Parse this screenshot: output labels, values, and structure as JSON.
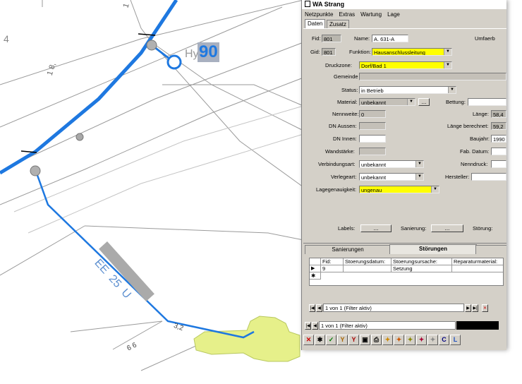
{
  "map": {
    "label_4": "4",
    "label_hy": "Hy",
    "label_90": "90",
    "label_18": "1 8,",
    "label_1": "1",
    "pipe_label": "EE  25  U",
    "label_32": "3,2",
    "label_66": "6 6"
  },
  "window": {
    "title": "WA Strang",
    "menu": [
      "Netzpunkte",
      "Extras",
      "Wartung",
      "Lage"
    ],
    "tabs": [
      "Daten",
      "Zusatz"
    ],
    "umfeld_label": "Umfaerb"
  },
  "form": {
    "fid_label": "Fid:",
    "fid_value": "801",
    "gid_label": "Gid:",
    "gid_value": "801",
    "name_label": "Name:",
    "name_value": "A. 631-A",
    "funktion_label": "Funktion:",
    "funktion_value": "Hausanschlussleitung",
    "druckzone_label": "Druckzone:",
    "druckzone_value": "Dorf/Bad 1",
    "gemeinde_label": "Gemeinde",
    "status_label": "Status:",
    "status_value": "in Betrieb",
    "material_label": "Material:",
    "material_value": "unbekannt",
    "material_btn": "...",
    "bettung_label": "Bettung:",
    "nennweite_label": "Nennweite:",
    "nennweite_value": "0",
    "laenge_label": "Länge:",
    "laenge_value": "58,4",
    "dn_aussen_label": "DN Aussen:",
    "laenge_ber_label": "Länge berechnet:",
    "laenge_ber_value": "59,2",
    "dn_innen_label": "DN Innen:",
    "baujahr_label": "Baujahr:",
    "baujahr_value": "1990",
    "wandstaerke_label": "Wandstärke:",
    "fab_datum_label": "Fab. Datum:",
    "verbindungsart_label": "Verbindungsart:",
    "verbindungsart_value": "unbekannt",
    "nenndruck_label": "Nenndruck:",
    "verlegeart_label": "Verlegeart:",
    "verlegeart_value": "unbekannt",
    "hersteller_label": "Hersteller:",
    "lagegenauigkeit_label": "Lagegenauigkeit:",
    "lagegenauigkeit_value": "ungenau",
    "labels_label": "Labels:",
    "labels_btn": "...",
    "sanierung_label": "Sanierung:",
    "sanierung_btn": "...",
    "stoerung_label": "Störung:"
  },
  "subform": {
    "tabs": [
      "Sanierungen",
      "Störungen"
    ],
    "columns": [
      "Fid:",
      "Stoerungsdatum:",
      "Stoerungsursache:",
      "Reparaturmaterial:"
    ],
    "rows": [
      [
        "9",
        "",
        "Setzung",
        ""
      ]
    ],
    "nav_text": "1 von 1 (Filter aktiv)"
  },
  "main_nav_text": "1 von 1 (Filter aktiv)",
  "toolbar": [
    "✕",
    "✱",
    "✓",
    "Y",
    "Y",
    "▣",
    "⎙",
    "✦",
    "✦",
    "✦",
    "✦",
    "✦",
    "C",
    "L"
  ],
  "colors": {
    "pipe_blue": "#1e78e0",
    "highlight_yellow": "#ffff00",
    "area_green": "#e6f08a"
  }
}
